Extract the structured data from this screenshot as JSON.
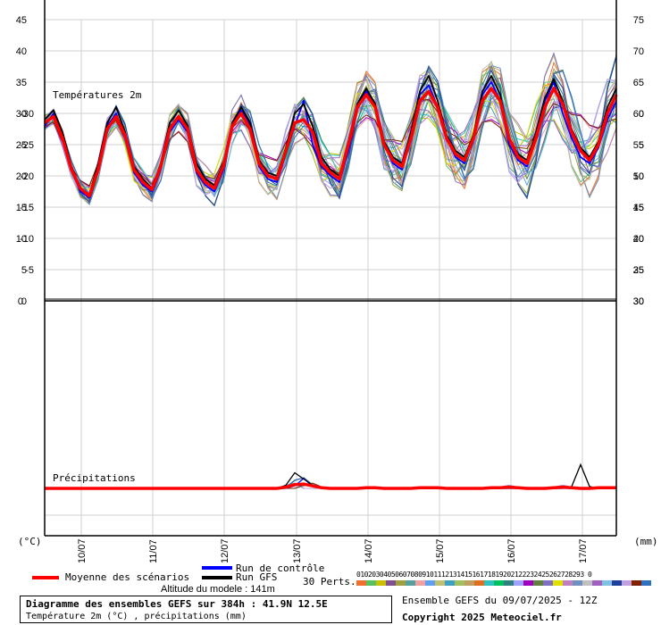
{
  "chart_data": {
    "type": "line",
    "title": "Diagramme des ensembles GEFS sur 384h : 41.9N 12.5E",
    "subtitle": "Température 2m (°C) , précipitations (mm)",
    "panels": {
      "temperature": {
        "label": "Températures 2m",
        "ylim": [
          0,
          45
        ],
        "yticks_left": [
          "45",
          "40",
          "35",
          "30",
          "25",
          "20",
          "15",
          "10",
          "5",
          "0"
        ],
        "yticks_right": [
          "75",
          "70",
          "65",
          "60",
          "55",
          "50",
          "45",
          "40",
          "35",
          "30"
        ]
      },
      "precipitation": {
        "label": "Précipitations",
        "ylim_left": [
          -30,
          0
        ],
        "yticks_left": [
          "0",
          "-5",
          "-10",
          "-15",
          "-20",
          "-25",
          "-30"
        ],
        "yticks_right": [
          "30",
          "25",
          "20",
          "15",
          "10",
          "5",
          "0"
        ]
      }
    },
    "x_dates": [
      "10/07",
      "11/07",
      "12/07",
      "13/07",
      "14/07",
      "15/07",
      "16/07",
      "17/07"
    ],
    "x_hours": [
      0,
      6,
      12,
      18,
      24,
      30,
      36,
      42,
      48,
      54,
      60,
      66,
      72,
      78,
      84,
      90,
      96,
      102,
      108,
      114,
      120,
      126,
      132,
      138,
      144,
      150,
      156,
      162,
      168,
      174,
      180,
      186,
      192,
      198,
      204,
      210,
      216,
      222,
      228,
      234,
      240,
      246,
      252,
      258,
      264,
      270,
      276,
      282,
      288,
      294,
      300,
      306,
      312,
      318,
      324,
      330,
      336,
      342,
      348,
      354,
      360,
      366,
      372,
      378,
      384
    ],
    "series": [
      {
        "name": "Moyenne des scénarios",
        "color": "#ff0000",
        "values": [
          28.5,
          29.5,
          26,
          21,
          18,
          16.8,
          21,
          27.5,
          29.5,
          26.5,
          21,
          19,
          17.8,
          21.5,
          27.5,
          29.5,
          27.5,
          21,
          19,
          18,
          21.5,
          28,
          30,
          27.5,
          22,
          20,
          19.5,
          24,
          28.5,
          29,
          27,
          22,
          20.5,
          19.5,
          25,
          31,
          33,
          31,
          25,
          22.5,
          21.5,
          26,
          32,
          33.5,
          31,
          26,
          23.5,
          22.5,
          26,
          32,
          34,
          32,
          26,
          23,
          22,
          26,
          31,
          34,
          31.5,
          27,
          24,
          22.5,
          25,
          30,
          33
        ]
      },
      {
        "name": "Run de contrôle",
        "color": "#0000ff",
        "values": [
          28,
          30,
          26.5,
          21,
          17.5,
          16.5,
          21.5,
          28,
          30,
          26,
          20.5,
          18.5,
          17.5,
          21,
          27,
          29,
          27,
          20.5,
          18.5,
          17.5,
          21,
          28.5,
          30.5,
          28,
          21.5,
          19.5,
          19,
          23.5,
          28,
          32,
          25,
          21.5,
          20,
          19,
          24,
          31,
          33.5,
          31,
          25,
          22,
          21,
          26.5,
          33,
          34.5,
          31,
          26,
          23,
          22,
          26.5,
          33,
          35,
          32,
          25,
          22.5,
          21.5,
          26.5,
          32,
          35,
          30,
          26,
          23,
          22,
          24.5,
          29,
          32
        ]
      },
      {
        "name": "Run GFS",
        "color": "#000000",
        "values": [
          29,
          30.5,
          27,
          21.5,
          18,
          17,
          22,
          28.5,
          31,
          27,
          21.5,
          19.5,
          18,
          22,
          28.5,
          30.5,
          28,
          22,
          19.5,
          18.5,
          22,
          28.5,
          31,
          28.5,
          22.5,
          20.5,
          20,
          24.5,
          30,
          31.5,
          28,
          23,
          21,
          20,
          25.5,
          31.5,
          34,
          31.5,
          25.5,
          23,
          22,
          27,
          33.5,
          36,
          32,
          26.5,
          24,
          23,
          26.5,
          33.5,
          36,
          33,
          26,
          23.5,
          22.5,
          27,
          32.5,
          35.5,
          32,
          27.5,
          24.5,
          23,
          25.5,
          31,
          34
        ]
      }
    ],
    "perturbations": {
      "count_label": "30 Perts.",
      "colors": [
        "#f07030",
        "#58c060",
        "#c8c000",
        "#805090",
        "#a0a040",
        "#58a0a0",
        "#f0a0a0",
        "#60a0f0",
        "#c0c070",
        "#40a0c0",
        "#a0c060",
        "#c0a060",
        "#e07020",
        "#30c0c0",
        "#00c060",
        "#308080",
        "#a0a0ff",
        "#a000c0",
        "#608040",
        "#8070c0",
        "#e0e000",
        "#c080c0",
        "#7090c0",
        "#c0c0c0",
        "#a060c0",
        "#80c0e0",
        "#2040a0",
        "#c0a0e0",
        "#802000",
        "#3070c0"
      ]
    },
    "precip_series": [
      {
        "name": "Moyenne des scénarios",
        "values": [
          0,
          0,
          0,
          0,
          0,
          0,
          0,
          0,
          0,
          0,
          0,
          0,
          0,
          0,
          0,
          0,
          0,
          0,
          0,
          0,
          0,
          0,
          0,
          0,
          0,
          0,
          0,
          0.2,
          0.6,
          0.7,
          0.4,
          0.1,
          0,
          0,
          0,
          0,
          0.1,
          0.1,
          0,
          0,
          0,
          0,
          0.1,
          0.1,
          0.1,
          0,
          0,
          0,
          0,
          0,
          0.1,
          0.1,
          0.2,
          0.1,
          0,
          0,
          0,
          0.1,
          0.2,
          0.1,
          0,
          0,
          0.1,
          0.1,
          0.1
        ]
      },
      {
        "name": "Run de contrôle",
        "values": [
          0,
          0,
          0,
          0,
          0,
          0,
          0,
          0,
          0,
          0,
          0,
          0,
          0,
          0,
          0,
          0,
          0,
          0,
          0,
          0,
          0,
          0,
          0,
          0,
          0,
          0,
          0,
          0,
          0.4,
          1.6,
          0.3,
          0,
          0,
          0,
          0,
          0,
          0,
          0,
          0,
          0,
          0,
          0,
          0,
          0,
          0,
          0,
          0,
          0,
          0,
          0,
          0,
          0,
          0,
          0,
          0,
          0,
          0,
          0,
          0,
          0,
          0,
          0,
          0,
          0,
          0
        ]
      },
      {
        "name": "Run GFS",
        "values": [
          0,
          0,
          0,
          0,
          0,
          0,
          0,
          0,
          0,
          0,
          0,
          0,
          0,
          0,
          0,
          0,
          0,
          0,
          0,
          0,
          0,
          0,
          0,
          0,
          0,
          0,
          0,
          0.5,
          2.5,
          1.5,
          0.5,
          0,
          0,
          0,
          0,
          0,
          0,
          0,
          0,
          0,
          0,
          0,
          0,
          0,
          0,
          0,
          0,
          0,
          0,
          0,
          0,
          0,
          0,
          0,
          0,
          0,
          0,
          0,
          0,
          0.3,
          3.8,
          0.3,
          0,
          0,
          0
        ]
      }
    ],
    "left_unit": "(°C)",
    "right_unit": "(mm)",
    "grid": true,
    "legend_position": "bottom-left"
  },
  "legend": {
    "mean_label": "Moyenne des scénarios",
    "control_label": "Run de contrôle",
    "gfs_label": "Run GFS",
    "perts_label": "30 Perts.",
    "pert_numbers": "01020304050607080910111213141516171819202122232425262728293 0",
    "altitude": "Altitude du modele : 141m"
  },
  "footer": {
    "title": "Diagramme des ensembles GEFS sur 384h : 41.9N 12.5E",
    "subtitle": "Température 2m (°C) , précipitations (mm)",
    "run_info": "Ensemble GEFS du 09/07/2025 - 12Z",
    "copyright": "Copyright 2025 Meteociel.fr"
  },
  "colors": {
    "mean": "#ff0000",
    "control": "#0000ff",
    "gfs": "#000000",
    "grid": "#d0d0d0"
  }
}
